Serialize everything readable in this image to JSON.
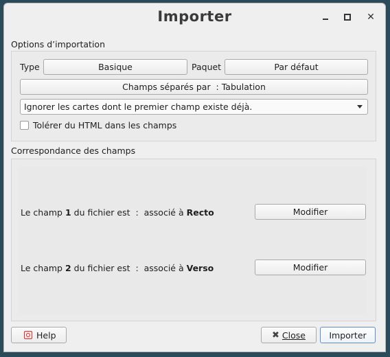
{
  "window": {
    "title": "Importer"
  },
  "options": {
    "section_label": "Options d’importation",
    "type_label": "Type",
    "type_value": "Basique",
    "deck_label": "Paquet",
    "deck_value": "Par défaut",
    "separator_button": "Champs séparés par  : Tabulation",
    "duplicate_select": "Ignorer les cartes dont le premier champ existe déjà.",
    "html_checkbox_label": "Tolérer du HTML dans les champs",
    "html_checkbox_checked": false
  },
  "mapping": {
    "section_label": "Correspondance des champs",
    "rows": [
      {
        "prefix": "Le champ ",
        "num": "1",
        "middle": " du fichier est  :  associé à ",
        "target": "Recto",
        "button": "Modifier"
      },
      {
        "prefix": "Le champ ",
        "num": "2",
        "middle": " du fichier est  :  associé à ",
        "target": "Verso",
        "button": "Modifier"
      }
    ]
  },
  "footer": {
    "help_label": "Help",
    "close_label": "Close",
    "import_label": "Importer"
  }
}
